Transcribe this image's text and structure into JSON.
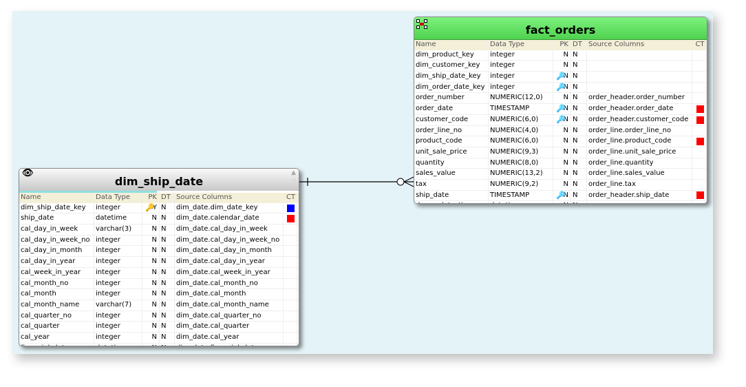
{
  "colors": {
    "canvas": "#e4f3f7",
    "fact_header": "#5ee05e",
    "dim_header": "#d8d8d8",
    "ct_red": "#ff0000",
    "ct_blue": "#0000ff",
    "key_gold": "#d8a020",
    "key_cyan": "#40a8d0"
  },
  "columns": {
    "name": "Name",
    "type": "Data Type",
    "pk": "PK",
    "dt": "DT",
    "source": "Source Columns",
    "ct": "CT"
  },
  "fact_orders": {
    "title": "fact_orders",
    "icon": "table-selection-icon",
    "rows": [
      {
        "name": "dim_product_key",
        "type": "integer",
        "key": "",
        "pk": "N",
        "dt": "N",
        "source": "",
        "ct": ""
      },
      {
        "name": "dim_customer_key",
        "type": "integer",
        "key": "",
        "pk": "N",
        "dt": "N",
        "source": "",
        "ct": ""
      },
      {
        "name": "dim_ship_date_key",
        "type": "integer",
        "key": "cyan",
        "pk": "N",
        "dt": "N",
        "source": "",
        "ct": ""
      },
      {
        "name": "dim_order_date_key",
        "type": "integer",
        "key": "cyan",
        "pk": "N",
        "dt": "N",
        "source": "",
        "ct": ""
      },
      {
        "name": "order_number",
        "type": "NUMERIC(12,0)",
        "key": "",
        "pk": "N",
        "dt": "N",
        "source": "order_header.order_number",
        "ct": ""
      },
      {
        "name": "order_date",
        "type": "TIMESTAMP",
        "key": "cyan",
        "pk": "N",
        "dt": "N",
        "source": "order_header.order_date",
        "ct": "red"
      },
      {
        "name": "customer_code",
        "type": "NUMERIC(6,0)",
        "key": "cyan",
        "pk": "N",
        "dt": "N",
        "source": "order_header.customer_code",
        "ct": "red"
      },
      {
        "name": "order_line_no",
        "type": "NUMERIC(4,0)",
        "key": "",
        "pk": "N",
        "dt": "N",
        "source": "order_line.order_line_no",
        "ct": ""
      },
      {
        "name": "product_code",
        "type": "NUMERIC(6,0)",
        "key": "",
        "pk": "N",
        "dt": "N",
        "source": "order_line.product_code",
        "ct": "red"
      },
      {
        "name": "unit_sale_price",
        "type": "NUMERIC(9,3)",
        "key": "",
        "pk": "N",
        "dt": "N",
        "source": "order_line.unit_sale_price",
        "ct": ""
      },
      {
        "name": "quantity",
        "type": "NUMERIC(8,0)",
        "key": "",
        "pk": "N",
        "dt": "N",
        "source": "order_line.quantity",
        "ct": ""
      },
      {
        "name": "sales_value",
        "type": "NUMERIC(13,2)",
        "key": "",
        "pk": "N",
        "dt": "N",
        "source": "order_line.sales_value",
        "ct": ""
      },
      {
        "name": "tax",
        "type": "NUMERIC(9,2)",
        "key": "",
        "pk": "N",
        "dt": "N",
        "source": "order_line.tax",
        "ct": ""
      },
      {
        "name": "ship_date",
        "type": "TIMESTAMP",
        "key": "cyan",
        "pk": "N",
        "dt": "N",
        "source": "order_header.ship_date",
        "ct": "red"
      },
      {
        "name": "dss_update_time",
        "type": "datetime",
        "key": "",
        "pk": "N",
        "dt": "N",
        "source": "",
        "ct": ""
      }
    ]
  },
  "dim_ship_date": {
    "title": "dim_ship_date",
    "icon": "eye-icon",
    "rows": [
      {
        "name": "dim_ship_date_key",
        "type": "integer",
        "key": "gold",
        "pk": "Y",
        "dt": "N",
        "source": "dim_date.dim_date_key",
        "ct": "blue"
      },
      {
        "name": "ship_date",
        "type": "datetime",
        "key": "",
        "pk": "N",
        "dt": "N",
        "source": "dim_date.calendar_date",
        "ct": "red"
      },
      {
        "name": "cal_day_in_week",
        "type": "varchar(3)",
        "key": "",
        "pk": "N",
        "dt": "N",
        "source": "dim_date.cal_day_in_week",
        "ct": ""
      },
      {
        "name": "cal_day_in_week_no",
        "type": "integer",
        "key": "",
        "pk": "N",
        "dt": "N",
        "source": "dim_date.cal_day_in_week_no",
        "ct": ""
      },
      {
        "name": "cal_day_in_month",
        "type": "integer",
        "key": "",
        "pk": "N",
        "dt": "N",
        "source": "dim_date.cal_day_in_month",
        "ct": ""
      },
      {
        "name": "cal_day_in_year",
        "type": "integer",
        "key": "",
        "pk": "N",
        "dt": "N",
        "source": "dim_date.cal_day_in_year",
        "ct": ""
      },
      {
        "name": "cal_week_in_year",
        "type": "integer",
        "key": "",
        "pk": "N",
        "dt": "N",
        "source": "dim_date.cal_week_in_year",
        "ct": ""
      },
      {
        "name": "cal_month_no",
        "type": "integer",
        "key": "",
        "pk": "N",
        "dt": "N",
        "source": "dim_date.cal_month_no",
        "ct": ""
      },
      {
        "name": "cal_month",
        "type": "integer",
        "key": "",
        "pk": "N",
        "dt": "N",
        "source": "dim_date.cal_month",
        "ct": ""
      },
      {
        "name": "cal_month_name",
        "type": "varchar(7)",
        "key": "",
        "pk": "N",
        "dt": "N",
        "source": "dim_date.cal_month_name",
        "ct": ""
      },
      {
        "name": "cal_quarter_no",
        "type": "integer",
        "key": "",
        "pk": "N",
        "dt": "N",
        "source": "dim_date.cal_quarter_no",
        "ct": ""
      },
      {
        "name": "cal_quarter",
        "type": "integer",
        "key": "",
        "pk": "N",
        "dt": "N",
        "source": "dim_date.cal_quarter",
        "ct": ""
      },
      {
        "name": "cal_year",
        "type": "integer",
        "key": "",
        "pk": "N",
        "dt": "N",
        "source": "dim_date.cal_year",
        "ct": ""
      },
      {
        "name": "financial_date",
        "type": "datetime",
        "key": "",
        "pk": "N",
        "dt": "N",
        "source": "dim_date.financial_date",
        "ct": ""
      }
    ]
  }
}
